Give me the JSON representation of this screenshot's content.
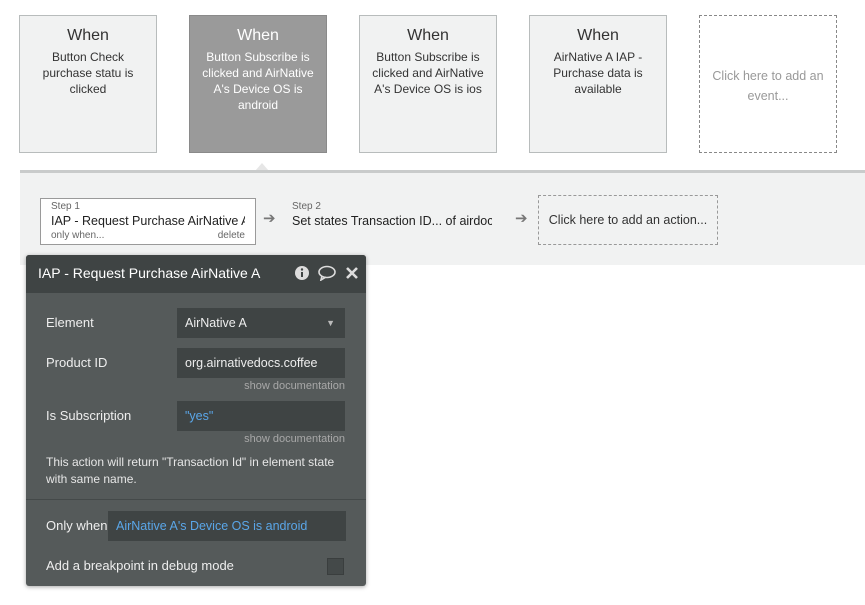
{
  "events": [
    {
      "when": "When",
      "desc": "Button Check purchase statu is clicked"
    },
    {
      "when": "When",
      "desc": "Button Subscribe is clicked and AirNative A's Device OS is android"
    },
    {
      "when": "When",
      "desc": "Button Subscribe is clicked and AirNative A's Device OS is ios"
    },
    {
      "when": "When",
      "desc": "AirNative A IAP - Purchase data is available"
    }
  ],
  "add_event_label": "Click here to add an event...",
  "steps": [
    {
      "num": "Step 1",
      "title": "IAP - Request Purchase AirNative A",
      "only_when": "only when...",
      "delete": "delete"
    },
    {
      "num": "Step 2",
      "title": "Set states Transaction ID... of airdocs"
    }
  ],
  "add_action_label": "Click here to add an action...",
  "panel": {
    "title": "IAP - Request Purchase AirNative A",
    "icons": [
      "info-icon",
      "comment-icon",
      "close-icon"
    ],
    "element_label": "Element",
    "element_value": "AirNative A",
    "product_id_label": "Product ID",
    "product_id_value": "org.airnativedocs.coffee",
    "show_documentation": "show documentation",
    "is_subscription_label": "Is Subscription",
    "is_subscription_value": "\"yes\"",
    "note": "This action will return \"Transaction Id\" in element state with same name.",
    "only_when_label": "Only when",
    "only_when_value": "AirNative A's Device OS is android",
    "breakpoint_label": "Add a breakpoint in debug mode"
  },
  "colors": {
    "link": "#5aa6e8",
    "panel_bg": "#555a5a",
    "panel_header": "#3f4444",
    "selected_event": "#9a9a9a"
  }
}
